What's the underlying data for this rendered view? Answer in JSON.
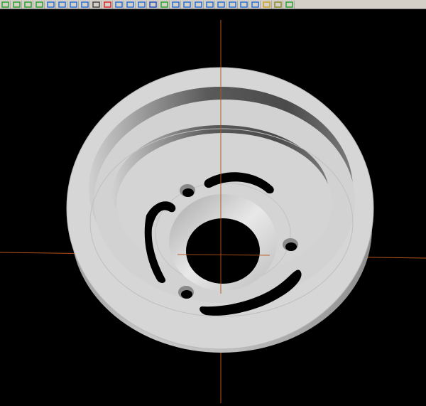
{
  "toolbar": {
    "buttons": [
      {
        "name": "view-cube-icon",
        "color": "#2ca02c"
      },
      {
        "name": "view-cube-icon",
        "color": "#2ca02c"
      },
      {
        "name": "view-cube-icon",
        "color": "#2ca02c"
      },
      {
        "name": "view-cube-icon",
        "color": "#2ca02c"
      },
      {
        "name": "view-cube-icon",
        "color": "#2a6fd6"
      },
      {
        "name": "view-cube-icon",
        "color": "#2a6fd6"
      },
      {
        "name": "view-cube-icon",
        "color": "#2a6fd6"
      },
      {
        "name": "view-cube-icon",
        "color": "#2a6fd6"
      },
      {
        "name": "pencil-icon",
        "color": "#444444"
      },
      {
        "name": "no-entry-icon",
        "color": "#d62728"
      },
      {
        "name": "axis-triad-icon",
        "color": "#2a6fd6"
      },
      {
        "name": "axis-arrows-icon",
        "color": "#2a6fd6"
      },
      {
        "name": "arrow-down-icon",
        "color": "#2a6fd6"
      },
      {
        "name": "sphere-icon",
        "color": "#1f4fbf"
      },
      {
        "name": "layers-icon",
        "color": "#2ca02c"
      },
      {
        "name": "sigma-icon",
        "color": "#2a6fd6"
      },
      {
        "name": "line-icon",
        "color": "#2a6fd6"
      },
      {
        "name": "line-icon",
        "color": "#2a6fd6"
      },
      {
        "name": "circle-icon",
        "color": "#2a6fd6"
      },
      {
        "name": "curve-icon",
        "color": "#2a6fd6"
      },
      {
        "name": "rectangle-icon",
        "color": "#2a6fd6"
      },
      {
        "name": "plus-icon",
        "color": "#2a6fd6"
      },
      {
        "name": "plane-icon",
        "color": "#2a6fd6"
      },
      {
        "name": "box-icon",
        "color": "#c9a227"
      },
      {
        "name": "stack-icon",
        "color": "#8a8a2a"
      },
      {
        "name": "close-icon",
        "color": "#2ca02c"
      }
    ]
  },
  "viewport": {
    "background_color": "#000000",
    "axis_color": "#b4541a",
    "part_color": "#d6d6d6"
  }
}
